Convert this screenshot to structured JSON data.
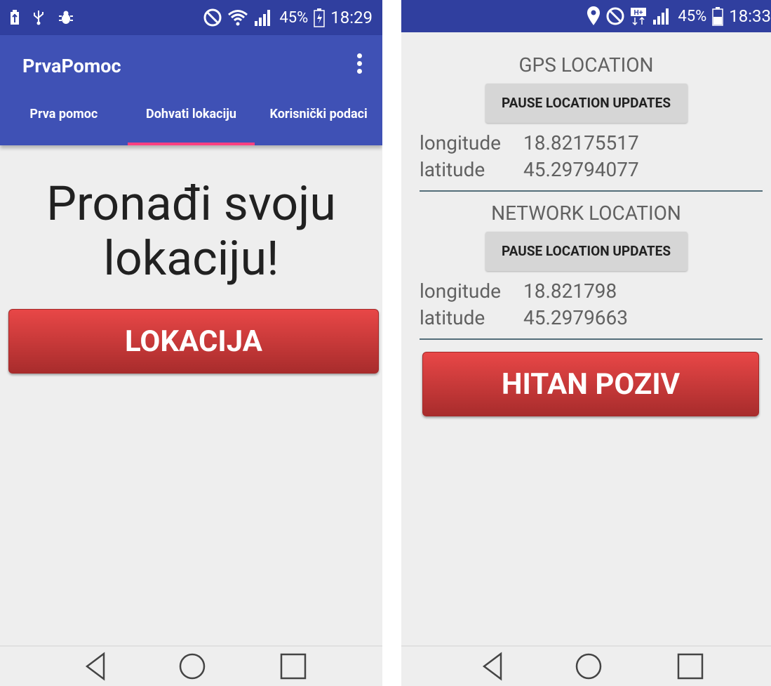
{
  "left_screen": {
    "status": {
      "battery": "45%",
      "time": "18:29"
    },
    "app_title": "PrvaPomoc",
    "tabs": [
      {
        "label": "Prva pomoc"
      },
      {
        "label": "Dohvati lokaciju"
      },
      {
        "label": "Korisnički podaci"
      }
    ],
    "headline_line1": "Pronađi svoju",
    "headline_line2": "lokaciju!",
    "location_button": "LOKACIJA"
  },
  "right_screen": {
    "status": {
      "battery": "45%",
      "time": "18:33"
    },
    "gps_title": "GPS LOCATION",
    "gps_pause_button": "PAUSE LOCATION UPDATES",
    "gps_longitude_label": "longitude",
    "gps_longitude_value": "18.82175517",
    "gps_latitude_label": "latitude",
    "gps_latitude_value": "45.29794077",
    "network_title": "NETWORK LOCATION",
    "network_pause_button": "PAUSE LOCATION UPDATES",
    "network_longitude_label": "longitude",
    "network_longitude_value": "18.821798",
    "network_latitude_label": "latitude",
    "network_latitude_value": "45.2979663",
    "emergency_button": "HITAN POZIV"
  },
  "colors": {
    "status_bar": "#303f9f",
    "app_bar": "#3f51b5",
    "tab_indicator": "#ff4081",
    "button_red_top": "#e84747",
    "button_red_bottom": "#a82c2c"
  },
  "icons": [
    "usb-icon",
    "bug-icon",
    "mute-icon",
    "wifi-icon",
    "signal-icon",
    "battery-charging-icon",
    "location-pin-icon",
    "hplus-icon",
    "battery-icon",
    "back-icon",
    "home-icon",
    "recents-icon",
    "overflow-menu-icon"
  ]
}
